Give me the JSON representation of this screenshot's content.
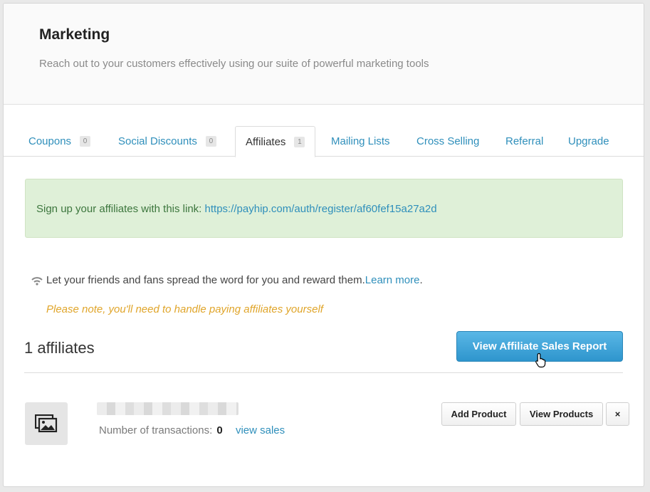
{
  "header": {
    "title": "Marketing",
    "subtitle": "Reach out to your customers effectively using our suite of powerful marketing tools"
  },
  "tabs": [
    {
      "label": "Coupons",
      "count": "0"
    },
    {
      "label": "Social Discounts",
      "count": "0"
    },
    {
      "label": "Affiliates",
      "count": "1",
      "active": true
    },
    {
      "label": "Mailing Lists"
    },
    {
      "label": "Cross Selling"
    },
    {
      "label": "Referral"
    },
    {
      "label": "Upgrade"
    }
  ],
  "signup": {
    "text": "Sign up your affiliates with this link: ",
    "link": "https://payhip.com/auth/register/af60fef15a27a2d"
  },
  "info": {
    "icon": "wifi-icon",
    "text": "Let your friends and fans spread the word for you and reward them. ",
    "learn_more": "Learn more",
    "period": ".",
    "note": "Please note, you'll need to handle paying affiliates yourself"
  },
  "affiliates": {
    "count_label": "1 affiliates",
    "report_button": "View Affiliate Sales Report"
  },
  "affiliate_row": {
    "tx_label": "Number of transactions:",
    "tx_value": "0",
    "view_sales": "view sales",
    "add_product": "Add Product",
    "view_products": "View Products",
    "remove": "×"
  },
  "colors": {
    "link": "#2f8fbb",
    "note": "#e0a52a",
    "button": "#3aa2d8"
  }
}
